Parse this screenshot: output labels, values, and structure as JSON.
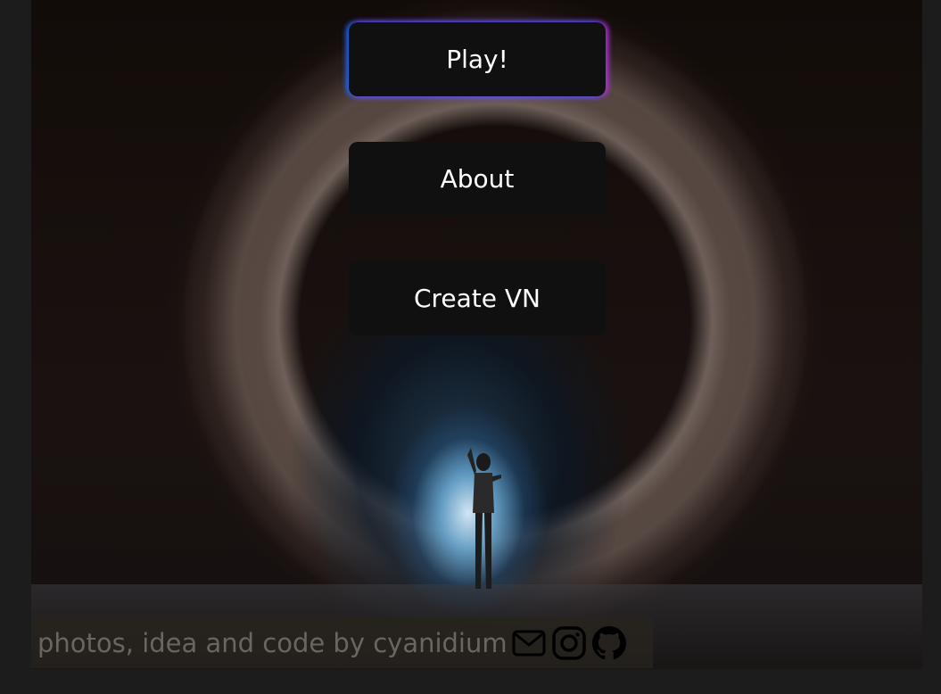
{
  "menu": {
    "play_label": "Play!",
    "about_label": "About",
    "create_label": "Create VN"
  },
  "footer": {
    "credit": "photos, idea and code by cyanidium",
    "icons": [
      "mail-icon",
      "instagram-icon",
      "github-icon"
    ]
  },
  "colors": {
    "button_bg": "#101010",
    "button_text": "#ffffff",
    "glow_blue": "#0078ff",
    "glow_purple": "#be28dc",
    "credit_text": "#6a6560"
  }
}
